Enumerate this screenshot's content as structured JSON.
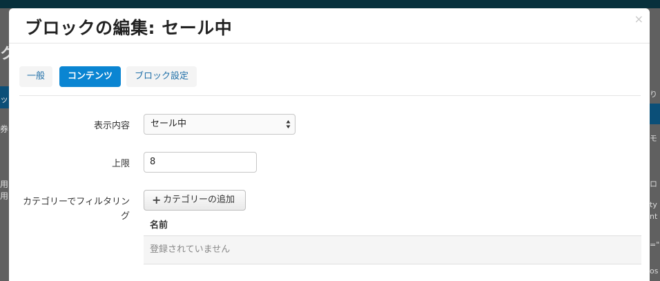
{
  "modal": {
    "title": "ブロックの編集: セール中",
    "close_glyph": "×"
  },
  "tabs": [
    {
      "label": "一般",
      "active": false
    },
    {
      "label": "コンテンツ",
      "active": true
    },
    {
      "label": "ブロック設定",
      "active": false
    }
  ],
  "form": {
    "display": {
      "label": "表示内容",
      "value": "セール中"
    },
    "limit": {
      "label": "上限",
      "value": "8"
    },
    "category_filter": {
      "label_line1": "カテゴリーでフィルタリン",
      "label_line2": "グ",
      "add_button_label": "カテゴリーの追加",
      "add_button_icon": "plus-icon",
      "column_header": "名前",
      "empty_message": "登録されていません"
    }
  },
  "colors": {
    "active_tab": "#0a85d2",
    "tab_text": "#1f6fa8"
  }
}
